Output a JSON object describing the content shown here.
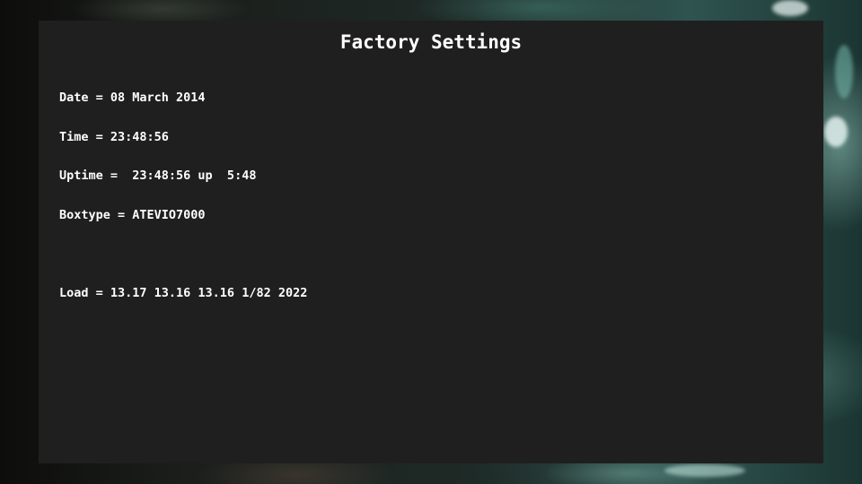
{
  "panel": {
    "title": "Factory Settings"
  },
  "info": {
    "date": "Date = 08 March 2014",
    "time": "Time = 23:48:56",
    "uptime": "Uptime =  23:48:56 up  5:48",
    "boxtype": "Boxtype = ATEVIO7000",
    "load": "Load = 13.17 13.16 13.16 1/82 2022"
  },
  "colors": {
    "panel_background": "#1f1f1f",
    "text": "#ffffff"
  }
}
